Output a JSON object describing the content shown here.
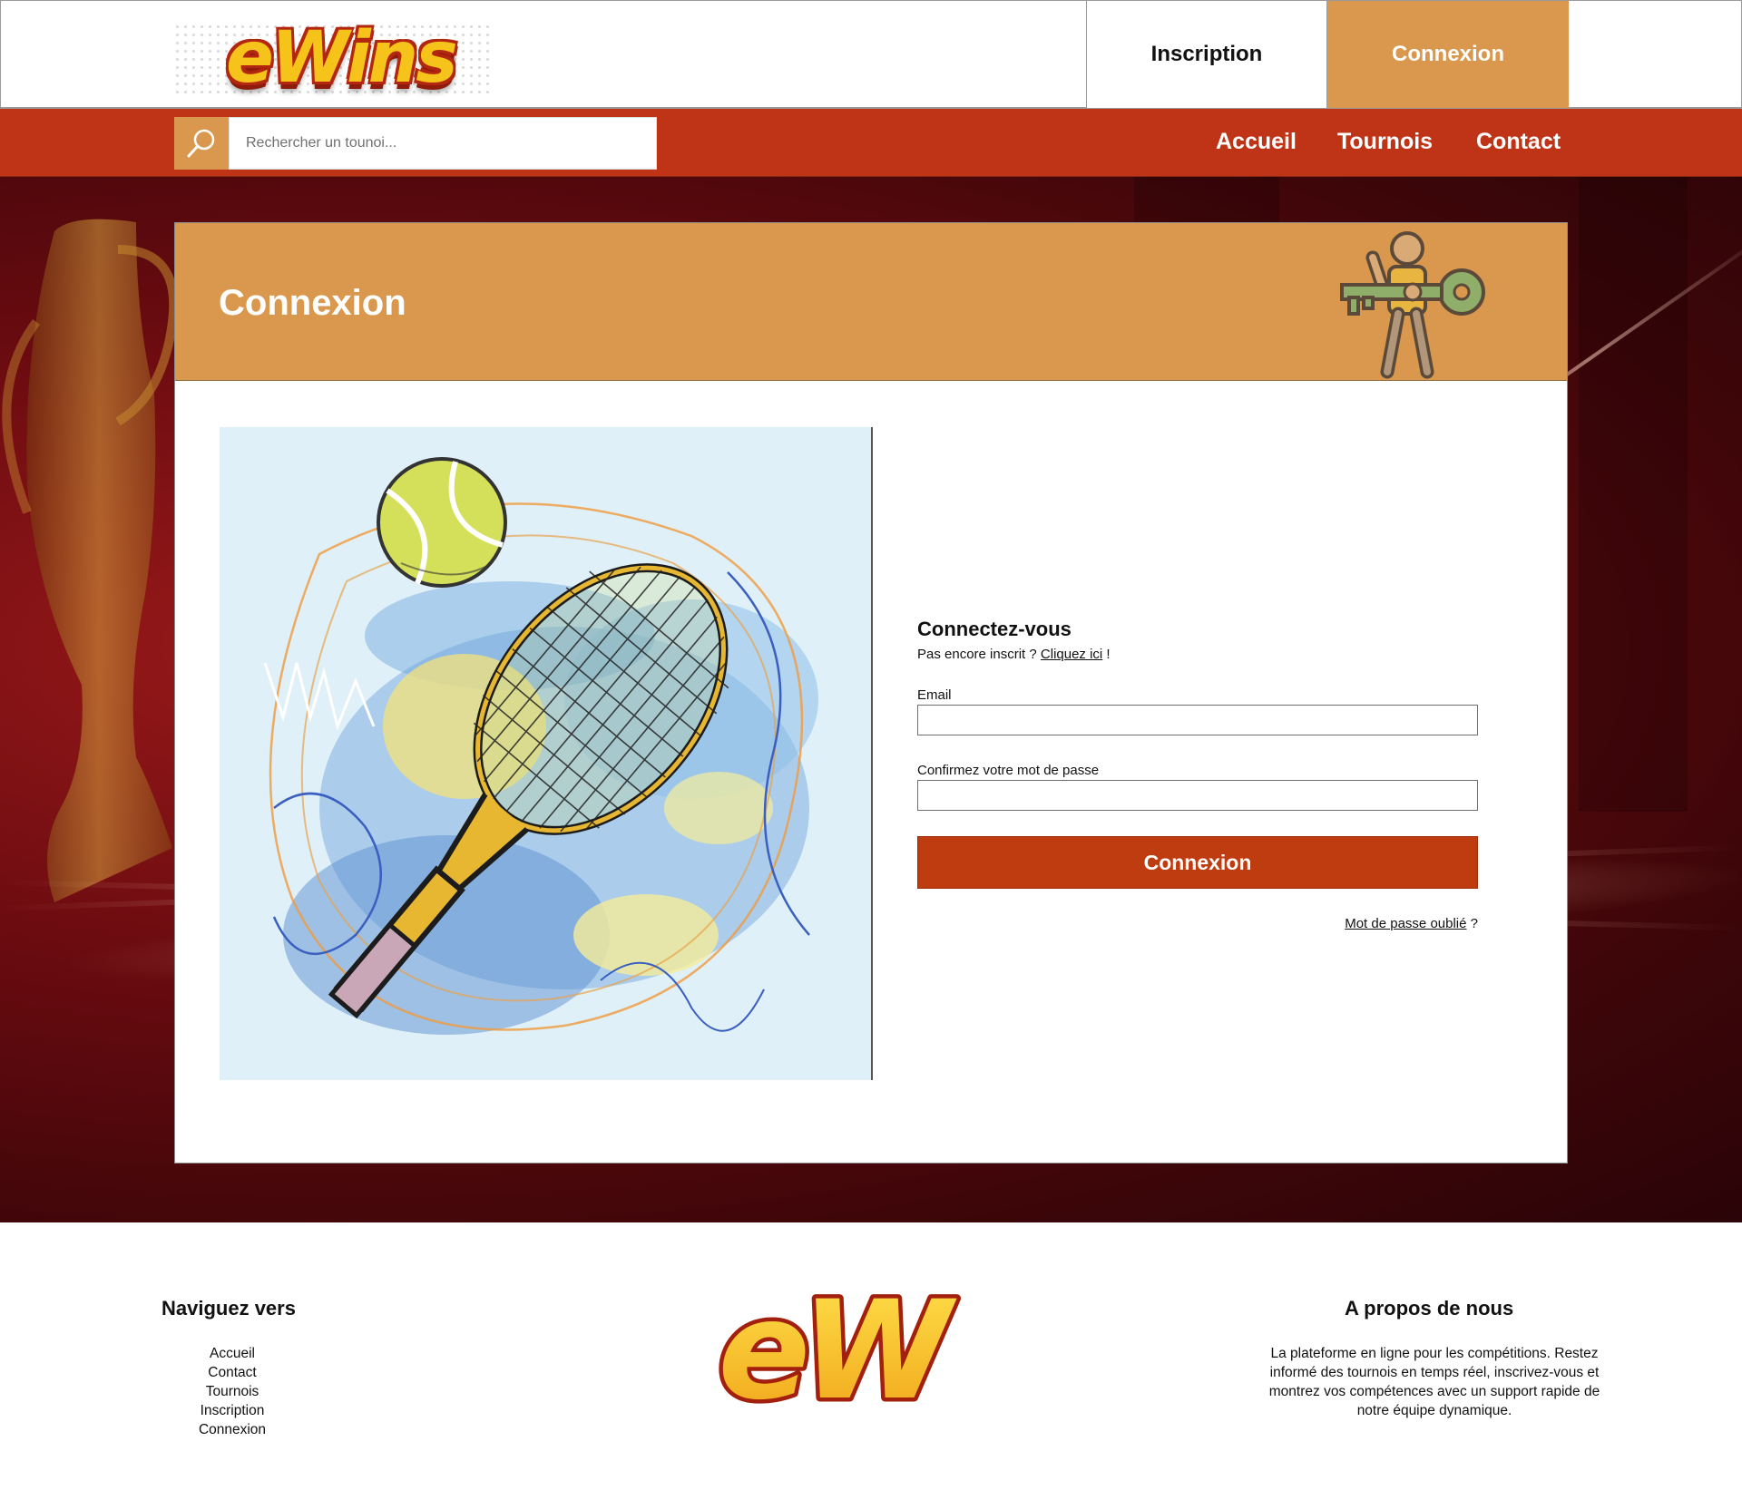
{
  "header": {
    "logo_text": "eWins",
    "tabs": [
      {
        "label": "Inscription"
      },
      {
        "label": "Connexion",
        "active": true
      }
    ]
  },
  "nav": {
    "search_placeholder": "Rechercher un tounoi...",
    "links": [
      "Accueil",
      "Tournois",
      "Contact"
    ]
  },
  "card": {
    "title": "Connexion",
    "illustration": "tennis-racket-and-ball-sketch"
  },
  "form": {
    "title": "Connectez-vous",
    "subtitle_prefix": "Pas encore inscrit ? ",
    "subtitle_link": "Cliquez ici",
    "subtitle_suffix": " !",
    "email_label": "Email",
    "email_value": "",
    "password_label": "Confirmez votre mot de passe",
    "password_value": "",
    "submit_label": "Connexion",
    "forgot_link": "Mot de passe oublié",
    "forgot_suffix": " ?"
  },
  "footer": {
    "nav_title": "Naviguez vers",
    "nav_links": [
      "Accueil",
      "Contact",
      "Tournois",
      "Inscription",
      "Connexion"
    ],
    "logo_text": "eW",
    "about_title": "A propos de nous",
    "about_text": "La plateforme en ligne pour les compétitions. Restez informé des tournois en temps réel, inscrivez-vous et montrez vos compétences avec un support rapide de notre équipe dynamique."
  },
  "colors": {
    "accent_orange": "#d9984d",
    "brand_red": "#bf3416",
    "button_red": "#bf3c10",
    "logo_yellow": "#f6c31a"
  }
}
